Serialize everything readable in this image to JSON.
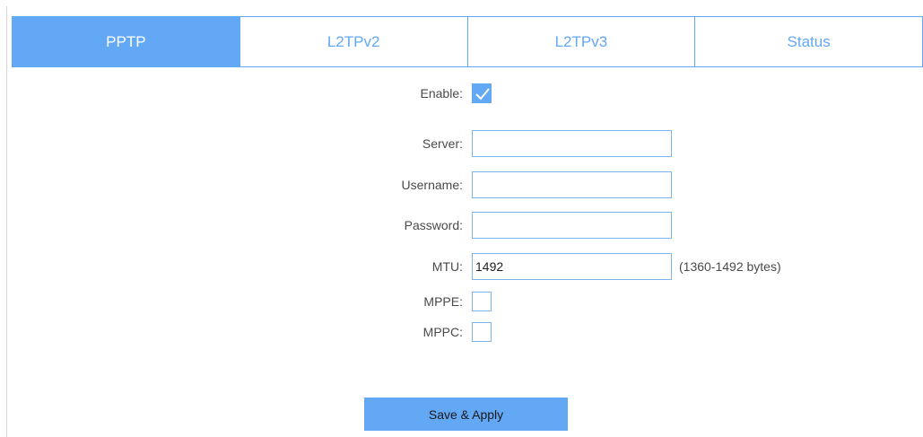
{
  "tabs": [
    {
      "label": "PPTP",
      "active": true
    },
    {
      "label": "L2TPv2",
      "active": false
    },
    {
      "label": "L2TPv3",
      "active": false
    },
    {
      "label": "Status",
      "active": false
    }
  ],
  "form": {
    "enable": {
      "label": "Enable:",
      "checked": true
    },
    "server": {
      "label": "Server:",
      "value": ""
    },
    "username": {
      "label": "Username:",
      "value": ""
    },
    "password": {
      "label": "Password:",
      "value": ""
    },
    "mtu": {
      "label": "MTU:",
      "value": "1492",
      "hint": "(1360-1492 bytes)"
    },
    "mppe": {
      "label": "MPPE:",
      "checked": false
    },
    "mppc": {
      "label": "MPPC:",
      "checked": false
    }
  },
  "actions": {
    "save_label": "Save & Apply"
  },
  "colors": {
    "accent": "#62a8f5",
    "border": "#7db4ec",
    "text": "#4a4a4a"
  }
}
